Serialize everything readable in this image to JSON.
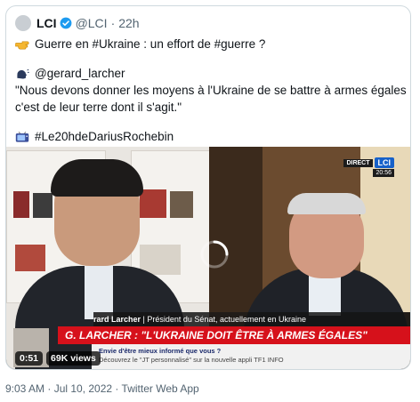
{
  "tweet": {
    "author_name": "LCI",
    "handle": "@LCI",
    "separator": "·",
    "time_ago": "22h",
    "lines": {
      "line1": "Guerre en #Ukraine : un effort de #guerre ?",
      "line2": "@gerard_larcher",
      "line3": "\"Nous devons donner les moyens à l'Ukraine de se battre à armes égales car",
      "line4": "c'est de leur terre dont il s'agit.\"",
      "line5": "#Le20hdeDariusRochebin"
    },
    "icons": {
      "line1": "pointing-hand-icon",
      "line2": "speaking-head-icon",
      "line5": "television-icon"
    }
  },
  "video": {
    "live_label": "DIRECT",
    "channel_badge": "LCI",
    "clock": "20:56",
    "lower_third_name": "rard Larcher",
    "lower_third_role": "Président du Sénat, actuellement en Ukraine",
    "banner": "G. LARCHER : \"L'UKRAINE DOIT ÊTRE À ARMES ÉGALES\"",
    "ticker_line1": "Envie d'être mieux informé que vous ?",
    "ticker_line2": "Découvrez le \"JT personnalisé\" sur la nouvelle appli TF1 INFO",
    "duration": "0:51",
    "views": "69K views"
  },
  "footer": {
    "datetime": "9:03 AM · Jul 10, 2022",
    "separator": "·",
    "source": "Twitter Web App"
  },
  "colors": {
    "verified": "#1d9bf0",
    "banner": "#d6111b",
    "lci_blue": "#1761c9"
  }
}
